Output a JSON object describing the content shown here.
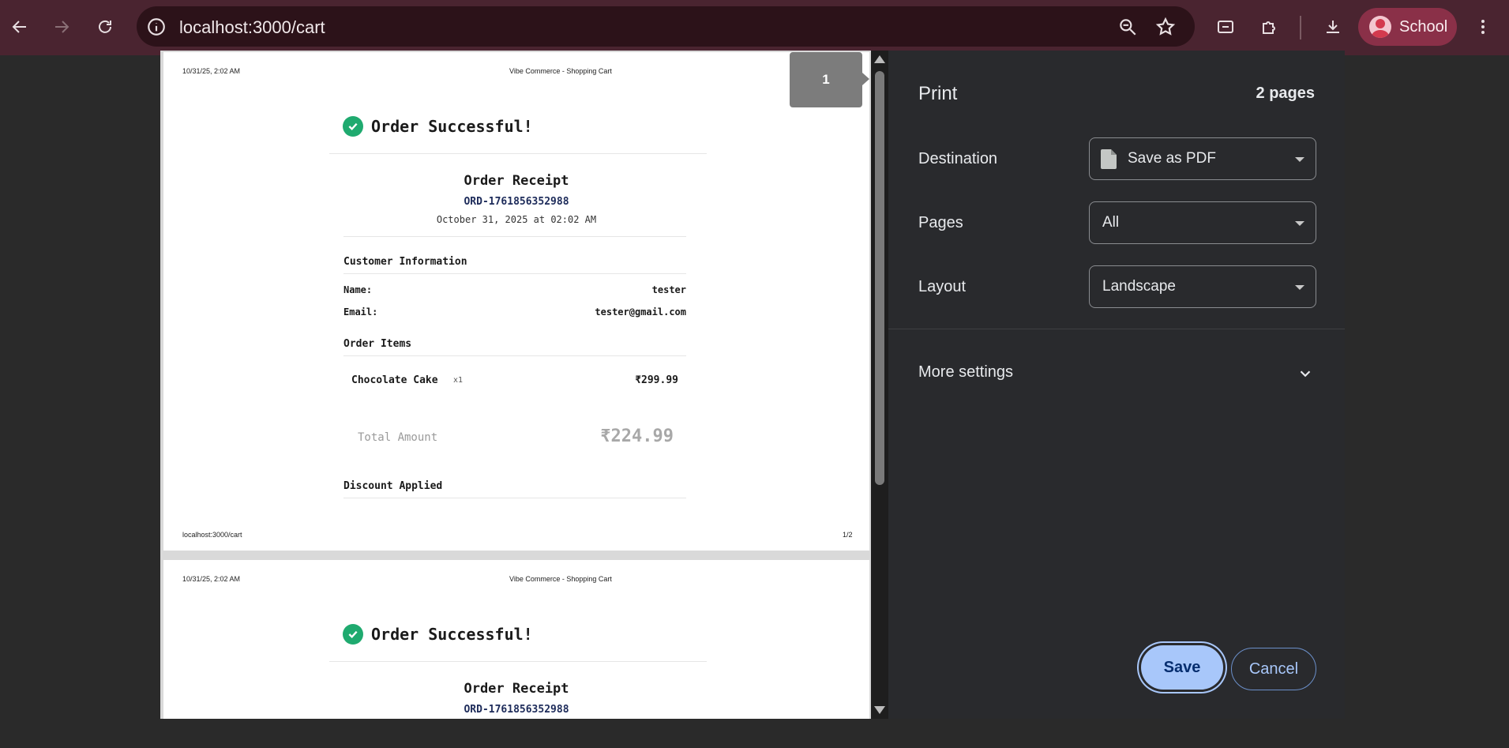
{
  "browser": {
    "url": "localhost:3000/cart",
    "profile_name": "School"
  },
  "preview": {
    "page_badge": "1",
    "page1": {
      "header_datetime": "10/31/25, 2:02 AM",
      "header_title": "Vibe Commerce - Shopping Cart",
      "success_title": "Order Successful!",
      "receipt_title": "Order Receipt",
      "order_id": "ORD-1761856352988",
      "order_date": "October 31, 2025 at 02:02 AM",
      "customer_section": "Customer Information",
      "name_label": "Name:",
      "name_value": "tester",
      "email_label": "Email:",
      "email_value": "tester@gmail.com",
      "items_section": "Order Items",
      "item_name": "Chocolate Cake",
      "item_qty": "x1",
      "item_price": "₹299.99",
      "total_label": "Total Amount",
      "total_value": "₹224.99",
      "discount_label": "Discount Applied",
      "footer_url": "localhost:3000/cart",
      "footer_page": "1/2"
    },
    "page2": {
      "header_datetime": "10/31/25, 2:02 AM",
      "header_title": "Vibe Commerce - Shopping Cart",
      "success_title": "Order Successful!",
      "receipt_title": "Order Receipt",
      "order_id": "ORD-1761856352988"
    }
  },
  "print_settings": {
    "title": "Print",
    "page_count": "2 pages",
    "destination_label": "Destination",
    "destination_value": "Save as PDF",
    "pages_label": "Pages",
    "pages_value": "All",
    "layout_label": "Layout",
    "layout_value": "Landscape",
    "more_settings": "More settings",
    "save_label": "Save",
    "cancel_label": "Cancel"
  },
  "colors": {
    "toolbar": "#4a2430",
    "accent": "#a8c7fa",
    "success": "#1faa6f"
  }
}
